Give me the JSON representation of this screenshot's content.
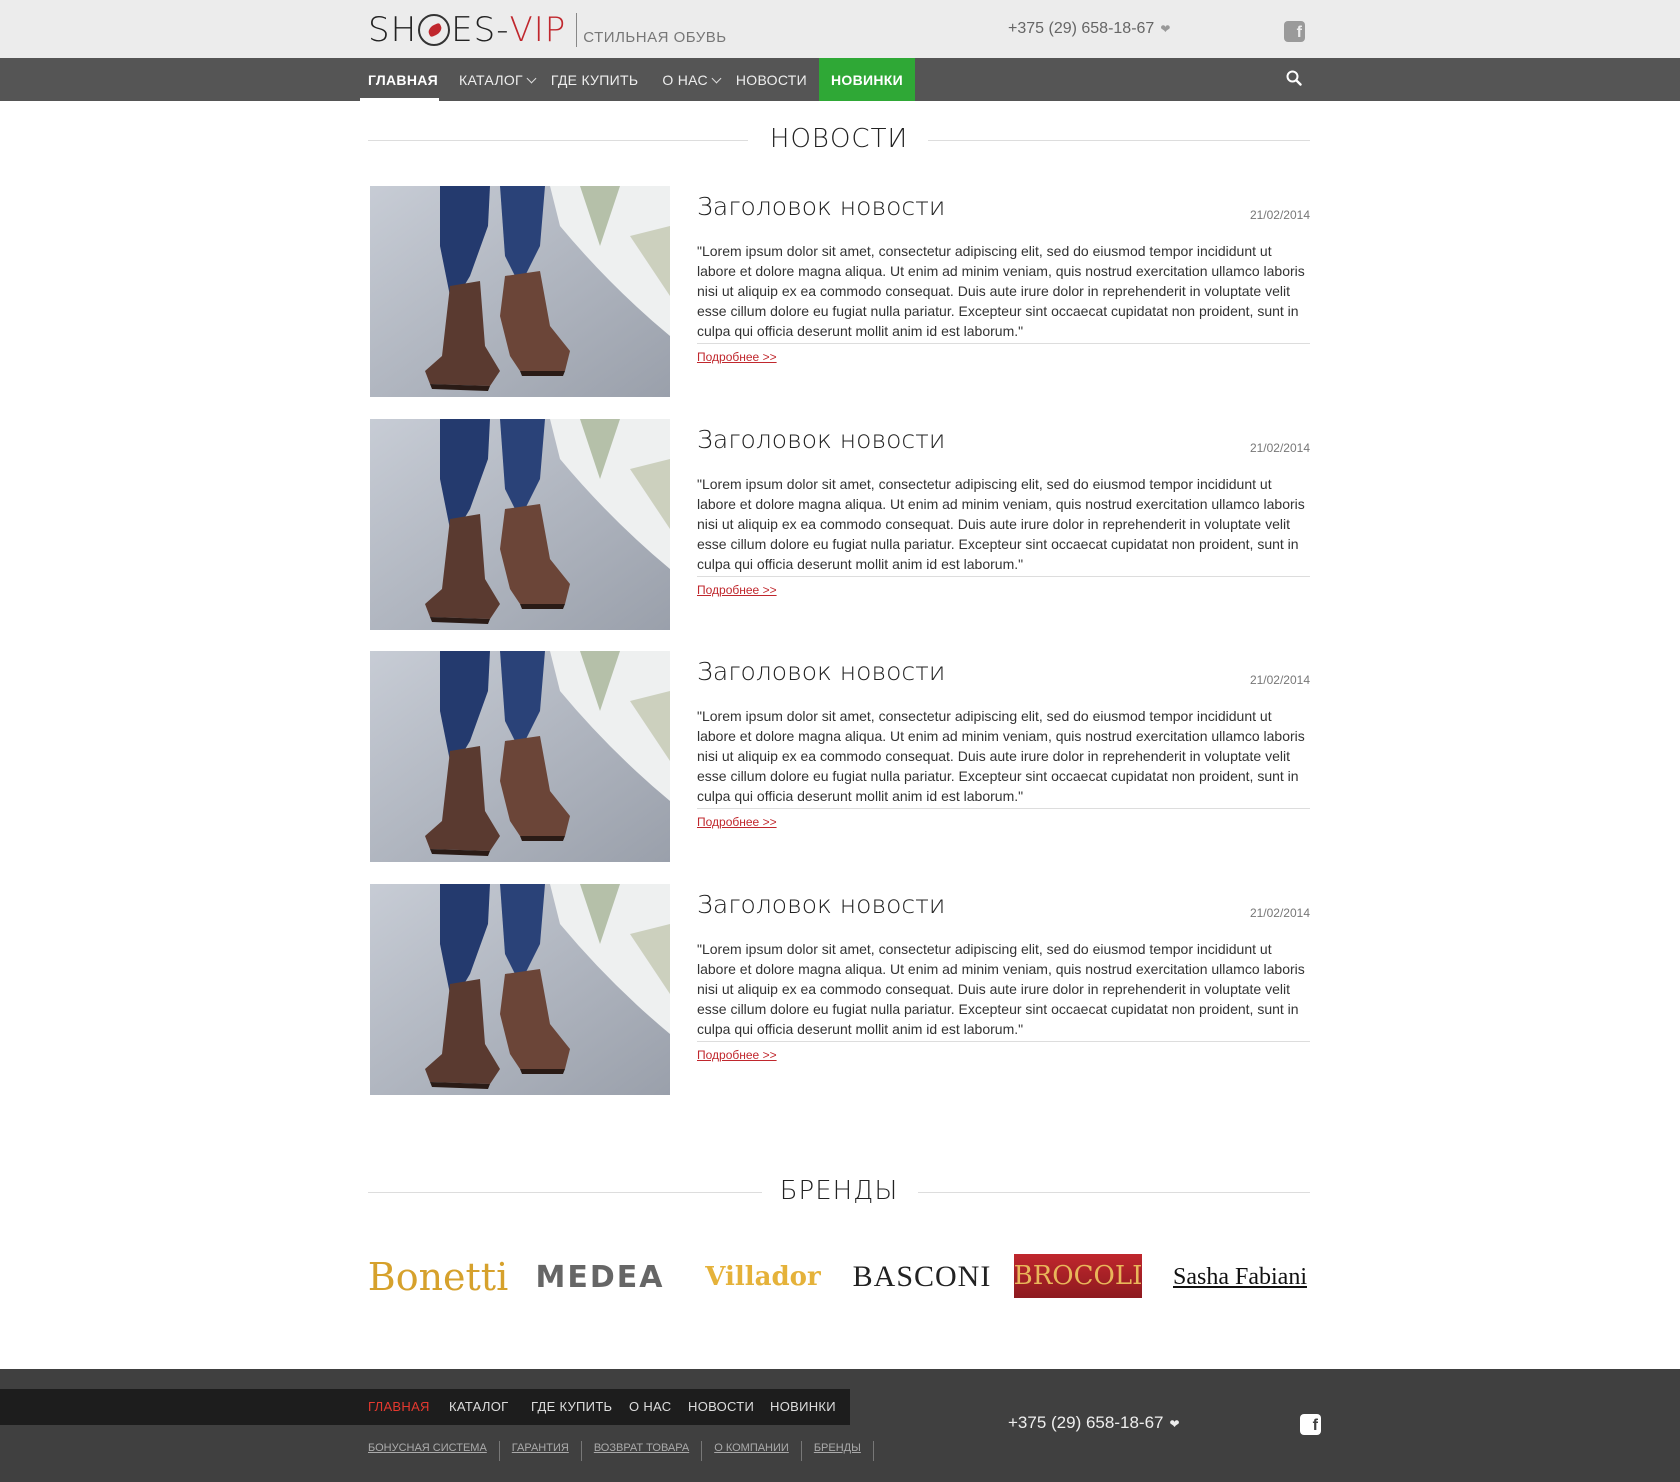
{
  "header": {
    "logo_left": "SH",
    "logo_right": "ES-",
    "logo_vip": "VIP",
    "tagline": "стильная обувь",
    "phone": "+375 (29) 658-18-67",
    "heart": "❤",
    "fb": "f"
  },
  "nav": {
    "items": [
      {
        "label": "ГЛАВНАЯ"
      },
      {
        "label": "КАТАЛОГ"
      },
      {
        "label": "ГДЕ КУПИТЬ"
      },
      {
        "label": "О НАС"
      },
      {
        "label": "НОВОСТИ"
      },
      {
        "label": "НОВИНКИ"
      }
    ]
  },
  "news_section": {
    "title": "НОВОСТИ",
    "items": [
      {
        "title": "Заголовок новости",
        "date": "21/02/2014",
        "text": "\"Lorem ipsum dolor sit amet, consectetur adipiscing elit, sed do eiusmod tempor incididunt ut labore et dolore magna aliqua. Ut enim ad minim veniam, quis nostrud exercitation ullamco laboris nisi ut aliquip ex ea commodo consequat. Duis aute irure dolor in reprehenderit in voluptate velit esse cillum dolore eu fugiat nulla pariatur. Excepteur sint occaecat cupidatat non proident, sunt in culpa qui officia deserunt mollit anim id est laborum.\"",
        "more": "Подробнее >>"
      },
      {
        "title": "Заголовок новости",
        "date": "21/02/2014",
        "text": "\"Lorem ipsum dolor sit amet, consectetur adipiscing elit, sed do eiusmod tempor incididunt ut labore et dolore magna aliqua. Ut enim ad minim veniam, quis nostrud exercitation ullamco laboris nisi ut aliquip ex ea commodo consequat. Duis aute irure dolor in reprehenderit in voluptate velit esse cillum dolore eu fugiat nulla pariatur. Excepteur sint occaecat cupidatat non proident, sunt in culpa qui officia deserunt mollit anim id est laborum.\"",
        "more": "Подробнее >>"
      },
      {
        "title": "Заголовок новости",
        "date": "21/02/2014",
        "text": "\"Lorem ipsum dolor sit amet, consectetur adipiscing elit, sed do eiusmod tempor incididunt ut labore et dolore magna aliqua. Ut enim ad minim veniam, quis nostrud exercitation ullamco laboris nisi ut aliquip ex ea commodo consequat. Duis aute irure dolor in reprehenderit in voluptate velit esse cillum dolore eu fugiat nulla pariatur. Excepteur sint occaecat cupidatat non proident, sunt in culpa qui officia deserunt mollit anim id est laborum.\"",
        "more": "Подробнее >>"
      },
      {
        "title": "Заголовок новости",
        "date": "21/02/2014",
        "text": "\"Lorem ipsum dolor sit amet, consectetur adipiscing elit, sed do eiusmod tempor incididunt ut labore et dolore magna aliqua. Ut enim ad minim veniam, quis nostrud exercitation ullamco laboris nisi ut aliquip ex ea commodo consequat. Duis aute irure dolor in reprehenderit in voluptate velit esse cillum dolore eu fugiat nulla pariatur. Excepteur sint occaecat cupidatat non proident, sunt in culpa qui officia deserunt mollit anim id est laborum.\"",
        "more": "Подробнее >>"
      }
    ]
  },
  "brands_section": {
    "title": "БРЕНДЫ",
    "items": [
      "Bonetti",
      "MEDEA",
      "Villador",
      "BASCONI",
      "BROCOLI",
      "Sasha Fabiani"
    ]
  },
  "footer": {
    "nav": [
      "ГЛАВНАЯ",
      "КАТАЛОГ",
      "ГДЕ КУПИТЬ",
      "О НАС",
      "НОВОСТИ",
      "НОВИНКИ"
    ],
    "links": [
      "БОНУСНАЯ СИСТЕМА",
      "ГАРАНТИЯ",
      "ВОЗВРАТ ТОВАРА",
      "О КОМПАНИИ",
      "БРЕНДЫ"
    ],
    "phone": "+375 (29) 658-18-67",
    "heart": "❤",
    "fb": "f"
  },
  "colors": {
    "accent_red": "#c0272d",
    "nav_green": "#2fa836",
    "nav_bg": "#555555",
    "footer_bg": "#404040"
  }
}
